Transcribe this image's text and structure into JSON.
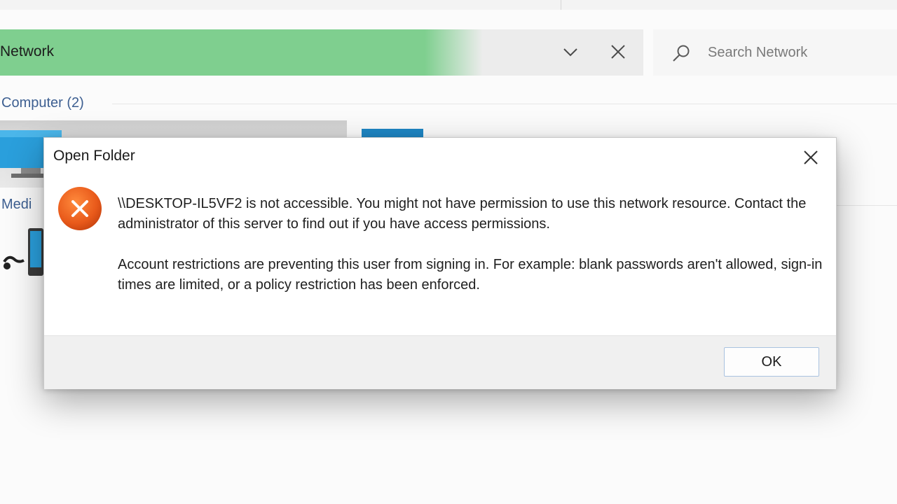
{
  "explorer": {
    "address_text": "Network",
    "address_progress_fraction": 0.75,
    "search_placeholder": "Search Network",
    "group_header": "Computer (2)",
    "media_label": "Medi"
  },
  "dialog": {
    "title": "Open Folder",
    "message_line1": "\\\\DESKTOP-IL5VF2  is not accessible. You might not have permission to use this network resource. Contact the administrator of this server to find out if you have access permissions.",
    "message_line2": "Account restrictions are preventing this user from signing in. For example: blank passwords aren't allowed, sign-in times are limited, or a policy restriction has been enforced.",
    "ok_label": "OK"
  },
  "icons": {
    "search": "search-icon",
    "chevron": "chevron-down-icon",
    "close": "close-icon",
    "error": "error-icon",
    "monitor": "monitor-icon",
    "media_device": "media-device-icon"
  },
  "colors": {
    "progress_green": "#7fcf8f",
    "error_orange": "#e8591a",
    "group_header_blue": "#3d5f91"
  }
}
